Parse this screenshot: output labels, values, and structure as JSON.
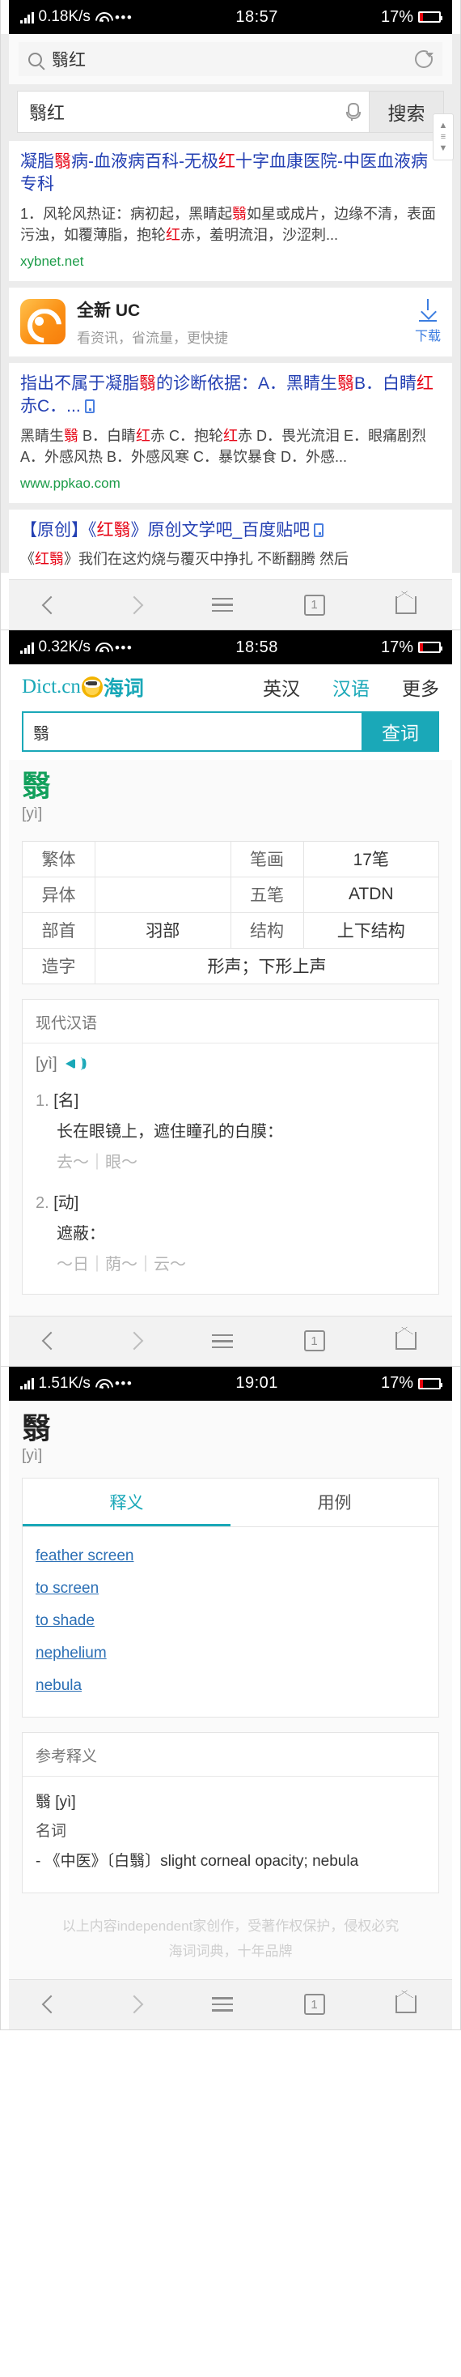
{
  "shots": [
    {
      "status": {
        "speed": "0.18K/s",
        "time": "18:57",
        "battery": "17%"
      },
      "search_suggestion": "翳红",
      "query_value": "翳红",
      "search_button": "搜索",
      "results": [
        {
          "title_parts": [
            {
              "t": "凝脂",
              "hl": false
            },
            {
              "t": "翳",
              "hl": true
            },
            {
              "t": "病-血液病百科-无极",
              "hl": false
            },
            {
              "t": "红",
              "hl": true
            },
            {
              "t": "十字血康医院-中医血液病专科",
              "hl": false
            }
          ],
          "snippet_parts": [
            {
              "t": "1．风轮风热证：病初起，黑睛起",
              "hl": false
            },
            {
              "t": "翳",
              "hl": true
            },
            {
              "t": "如星或成片，边缘不清，表面污浊，如覆薄脂，抱轮",
              "hl": false
            },
            {
              "t": "红",
              "hl": true
            },
            {
              "t": "赤，羞明流泪，沙涩刺...",
              "hl": false
            }
          ],
          "url": "xybnet.net"
        },
        {
          "title_parts": [
            {
              "t": "指出不属于凝脂",
              "hl": false
            },
            {
              "t": "翳",
              "hl": true
            },
            {
              "t": "的诊断依据：A．黑睛生",
              "hl": false
            },
            {
              "t": "翳",
              "hl": true
            },
            {
              "t": "B．白睛",
              "hl": false
            },
            {
              "t": "红",
              "hl": true
            },
            {
              "t": "赤C．...",
              "hl": false
            }
          ],
          "title_has_phone_icon": true,
          "snippet_parts": [
            {
              "t": "黑睛生",
              "hl": false
            },
            {
              "t": "翳",
              "hl": true
            },
            {
              "t": " B．白睛",
              "hl": false
            },
            {
              "t": "红",
              "hl": true
            },
            {
              "t": "赤 C．抱轮",
              "hl": false
            },
            {
              "t": "红",
              "hl": true
            },
            {
              "t": "赤 D．畏光流泪 E．眼痛剧烈 A．外感风热 B．外感风寒 C．暴饮暴食 D．外感...",
              "hl": false
            }
          ],
          "url": "www.ppkao.com"
        },
        {
          "title_parts": [
            {
              "t": "【原创】《",
              "hl": false
            },
            {
              "t": "红翳",
              "hl": true
            },
            {
              "t": "》原创文学吧_百度贴吧",
              "hl": false
            }
          ],
          "title_has_phone_icon": true,
          "snippet_parts": [
            {
              "t": "《",
              "hl": false
            },
            {
              "t": "红翳",
              "hl": true
            },
            {
              "t": "》我们在这灼烧与覆灭中挣扎 不断翻腾 然后",
              "hl": false
            }
          ],
          "url": ""
        }
      ],
      "ad": {
        "title": "全新 UC",
        "subtitle": "看资讯，省流量，更快捷",
        "cta": "下载"
      },
      "nav": {
        "tabs_count": "1"
      }
    },
    {
      "status": {
        "speed": "0.32K/s",
        "time": "18:58",
        "battery": "17%"
      },
      "brand": {
        "dictcn": "Dict.cn",
        "haici": "海词"
      },
      "nav_items": [
        {
          "label": "英汉",
          "active": false
        },
        {
          "label": "汉语",
          "active": true
        },
        {
          "label": "更多",
          "active": false
        }
      ],
      "query_value": "翳",
      "search_button": "查词",
      "headword": "翳",
      "pinyin": "[yì]",
      "info_table": [
        {
          "label1": "繁体",
          "value1": "",
          "label2": "笔画",
          "value2": "17笔"
        },
        {
          "label1": "异体",
          "value1": "",
          "label2": "五笔",
          "value2": "ATDN"
        },
        {
          "label1": "部首",
          "value1": "羽部",
          "label2": "结构",
          "value2": "上下结构"
        }
      ],
      "info_table_last": {
        "label": "造字",
        "value": "形声；下形上声"
      },
      "panel_title": "现代汉语",
      "pron": "[yì]",
      "senses": [
        {
          "num": "1.",
          "pos": "[名]",
          "def": "长在眼镜上，遮住瞳孔的白膜：",
          "ex": "去～｜眼～"
        },
        {
          "num": "2.",
          "pos": "[动]",
          "def": "遮蔽：",
          "ex": "～日｜荫～｜云～"
        }
      ],
      "nav": {
        "tabs_count": "1"
      }
    },
    {
      "status": {
        "speed": "1.51K/s",
        "time": "19:01",
        "battery": "17%"
      },
      "headword": "翳",
      "pinyin": "[yì]",
      "tabs": [
        {
          "label": "释义",
          "active": true
        },
        {
          "label": "用例",
          "active": false
        }
      ],
      "links": [
        "feather screen",
        "to screen",
        "to shade",
        "nephelium",
        "nebula"
      ],
      "ref_title": "参考释义",
      "ref_headword": "翳 [yì]",
      "ref_pos": "名词",
      "ref_entry": "- 《中医》〔白翳〕slight corneal opacity; nebula",
      "footer_line1": "以上内容independent家创作，受著作权保护，侵权必究",
      "footer_line2": "海词词典，十年品牌",
      "nav": {
        "tabs_count": "1"
      }
    }
  ],
  "colors": {
    "accent_teal": "#1aa8b8",
    "link_blue": "#2440b3",
    "highlight_red": "#e60012",
    "url_green": "#1d9c49",
    "battery_red": "#e8000d"
  }
}
